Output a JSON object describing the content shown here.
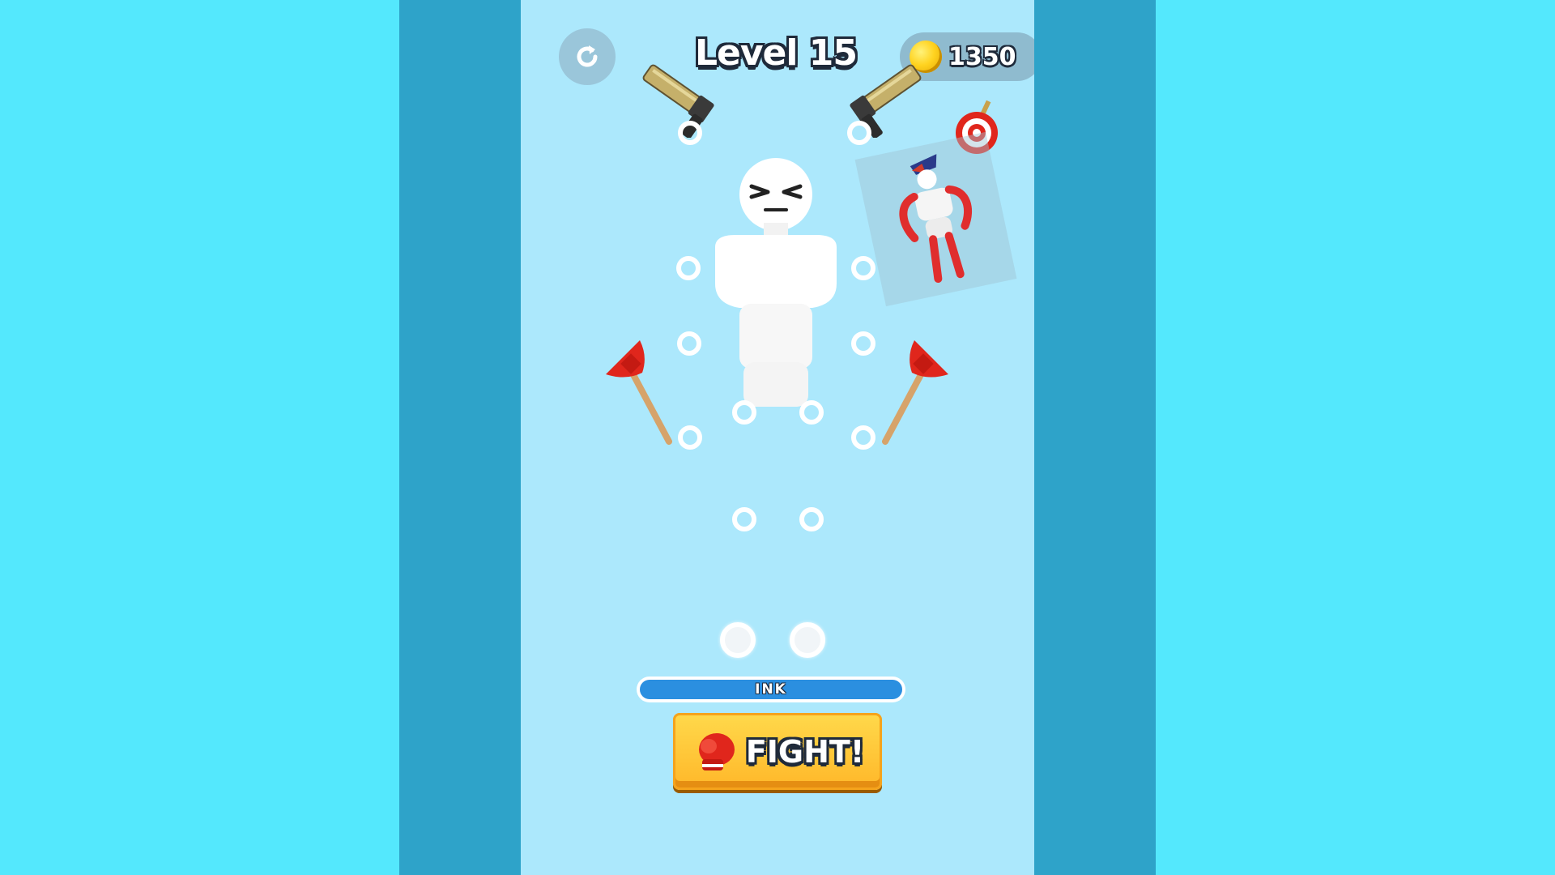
{
  "level": {
    "title": "Level 15"
  },
  "currency": {
    "coins": "1350",
    "icon": "coin-icon"
  },
  "controls": {
    "restart_icon": "restart-icon"
  },
  "ink": {
    "label": "INK",
    "fill_fraction": 1.0
  },
  "fight": {
    "label": "FIGHT!",
    "icon": "boxing-glove-icon"
  },
  "opponent": {
    "icon": "target-icon"
  },
  "colors": {
    "background": "#54e8fd",
    "side_bar": "#2ea3c9",
    "phone_bg": "#ace8fc",
    "ink_fill": "#2b8fe0",
    "fight_button": "#ffc83a",
    "plunger": "#e0261c"
  }
}
